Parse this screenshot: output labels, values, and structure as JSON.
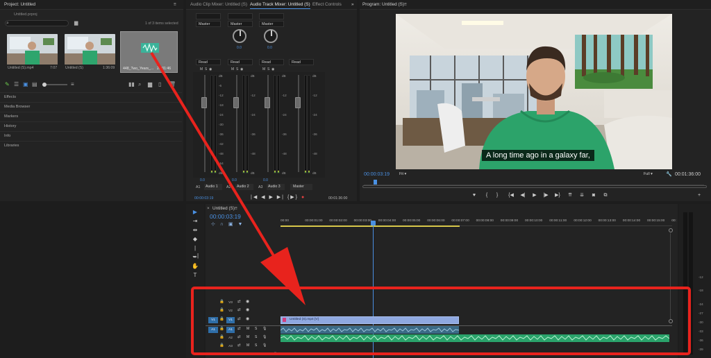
{
  "project": {
    "title": "Project: Untitled",
    "file": "Untitled.prproj",
    "selection": "1 of 3 items selected",
    "search_placeholder": "",
    "items": [
      {
        "name": "Untitled (S).mp4",
        "duration": "7:07"
      },
      {
        "name": "Untitled (S)",
        "duration": "1:36:09"
      },
      {
        "name": "448_Two_Years_...",
        "duration": "26:01:46"
      }
    ],
    "panels": [
      "Effects",
      "Media Browser",
      "Markers",
      "History",
      "Info",
      "Libraries"
    ]
  },
  "mixer": {
    "tabs": [
      "Audio Clip Mixer: Untitled (S)",
      "Audio Track Mixer: Untitled (S)",
      "Effect Controls"
    ],
    "channels": [
      {
        "output": "Master",
        "pan": "0.0",
        "mode": "Read",
        "level": "0.0",
        "name": "Audio 1",
        "code": "A1"
      },
      {
        "output": "Master",
        "pan": "0.0",
        "mode": "Read",
        "level": "0.0",
        "name": "Audio 2",
        "code": "A2"
      },
      {
        "output": "Master",
        "pan": "0.0",
        "mode": "Read",
        "level": "0.0",
        "name": "Audio 3",
        "code": "A3"
      }
    ],
    "master_label": "Master",
    "db_scale": [
      "dB",
      "-6",
      "-12",
      "-18",
      "-24",
      "-30",
      "-36",
      "-42",
      "-48",
      "-54",
      "dB"
    ],
    "timecode": "00:00:03:19",
    "duration": "00:01:36:00"
  },
  "program": {
    "title": "Program: Untitled (S)",
    "subtitle": "A long time ago in a galaxy far,",
    "timecode": "00:00:03:19",
    "fit": "Fit",
    "quality": "Full",
    "duration": "00:01:36:00"
  },
  "timeline": {
    "tab": "Untitled (S)",
    "timecode": "00:00:03:19",
    "ruler": [
      "00:00",
      "00:00:01:00",
      "00:00:02:00",
      "00:00:03:00",
      "00:00:04:00",
      "00:00:05:00",
      "00:00:06:00",
      "00:00:07:00",
      "00:00:08:00",
      "00:00:09:00",
      "00:00:10:00",
      "00:00:11:00",
      "00:00:12:00",
      "00:00:13:00",
      "00:00:14:00",
      "00:00:15:00",
      "00:"
    ],
    "tracks": [
      {
        "code": "V3",
        "type": "video"
      },
      {
        "code": "V2",
        "type": "video"
      },
      {
        "code": "V1",
        "type": "video",
        "source": "V1"
      },
      {
        "code": "A1",
        "type": "audio",
        "source": "A1"
      },
      {
        "code": "A2",
        "type": "audio"
      },
      {
        "code": "A3",
        "type": "audio"
      }
    ],
    "video_clip": "Untitled (S).mp4 [V]",
    "meter_scale": [
      "-12",
      "-18",
      "-24",
      "-27",
      "-30",
      "-33",
      "-36",
      "-39"
    ]
  },
  "colors": {
    "annotation": "#e8231d",
    "accent": "#4a90e2",
    "audio_clip": "#2aa36b",
    "video_clip": "#8fa8e0"
  }
}
